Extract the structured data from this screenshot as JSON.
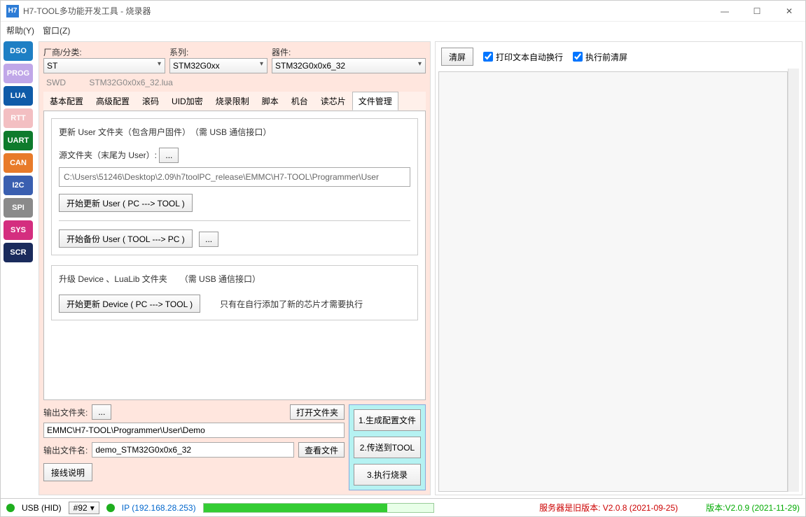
{
  "window": {
    "icon_text": "H7",
    "title": "H7-TOOL多功能开发工具 - 烧录器"
  },
  "menu": {
    "help": "帮助(Y)",
    "window": "窗口(Z)"
  },
  "sidebar": {
    "items": [
      {
        "id": "dso",
        "label": "DSO"
      },
      {
        "id": "prog",
        "label": "PROG"
      },
      {
        "id": "lua",
        "label": "LUA"
      },
      {
        "id": "rtt",
        "label": "RTT"
      },
      {
        "id": "uart",
        "label": "UART"
      },
      {
        "id": "can",
        "label": "CAN"
      },
      {
        "id": "i2c",
        "label": "I2C"
      },
      {
        "id": "spi",
        "label": "SPI"
      },
      {
        "id": "sys",
        "label": "SYS"
      },
      {
        "id": "scr",
        "label": "SCR"
      }
    ]
  },
  "selectors": {
    "vendor_label": "厂商/分类:",
    "vendor_value": "ST",
    "series_label": "系列:",
    "series_value": "STM32G0xx",
    "device_label": "器件:",
    "device_value": "STM32G0x0x6_32"
  },
  "swd_line": {
    "proto": "SWD",
    "lua": "STM32G0x0x6_32.lua"
  },
  "tabs": {
    "items": [
      "基本配置",
      "高级配置",
      "滚码",
      "UID加密",
      "烧录限制",
      "脚本",
      "机台",
      "读芯片",
      "文件管理"
    ],
    "active_index": 8
  },
  "file_mgmt": {
    "group1_title": "更新 User 文件夹（包含用户固件）　（需 USB 通信接口）",
    "src_label": "源文件夹（末尾为 User）:",
    "browse": "...",
    "src_path": "C:\\Users\\51246\\Desktop\\2.09\\h7toolPC_release\\EMMC\\H7-TOOL\\Programmer\\User",
    "btn_update_user": "开始更新 User ( PC ---> TOOL )",
    "btn_backup_user": "开始备份 User ( TOOL ---> PC )",
    "group2_title": "升级 Device 、LuaLib 文件夹　　（需 USB 通信接口）",
    "btn_update_device": "开始更新 Device ( PC ---> TOOL )",
    "device_note": "只有在自行添加了新的芯片才需要执行"
  },
  "output": {
    "folder_label": "输出文件夹:",
    "browse": "...",
    "open_folder": "打开文件夹",
    "folder_value": "EMMC\\H7-TOOL\\Programmer\\User\\Demo",
    "filename_label": "输出文件名:",
    "filename_value": "demo_STM32G0x0x6_32",
    "view_file": "查看文件",
    "wiring": "接线说明"
  },
  "actions": {
    "gen": "1.生成配置文件",
    "send": "2.传送到TOOL",
    "burn": "3.执行烧录"
  },
  "right": {
    "clear": "清屏",
    "auto_wrap": "打印文本自动换行",
    "clear_before": "执行前清屏"
  },
  "status": {
    "usb": "USB (HID)",
    "chan": "#92",
    "ip": "IP (192.168.28.253)",
    "server_old": "服务器是旧版本: V2.0.8 (2021-09-25)",
    "version": "版本:V2.0.9 (2021-11-29)"
  }
}
